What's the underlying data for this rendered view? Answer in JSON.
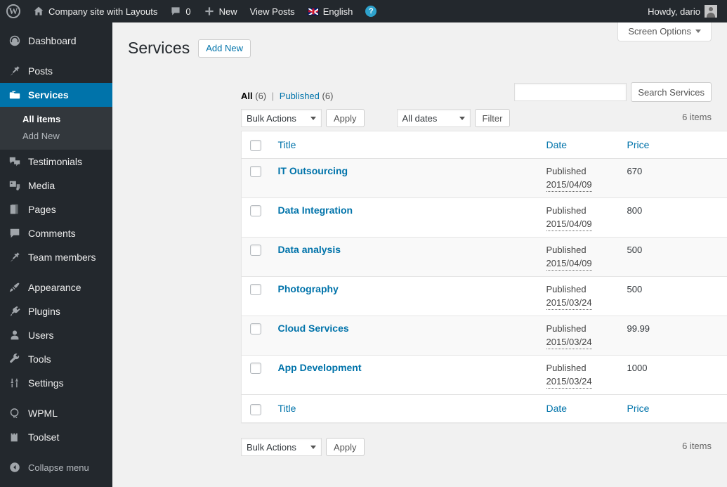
{
  "adminbar": {
    "logo_icon": "wordpress-logo",
    "site_icon": "home-icon",
    "site_name": "Company site with Layouts",
    "comments_icon": "comment-bubble-icon",
    "comments_count": "0",
    "new_icon": "plus-icon",
    "new_label": "New",
    "view_posts_label": "View Posts",
    "language_flag": "uk-flag-icon",
    "language_label": "English",
    "help_icon": "help-question-icon",
    "howdy": "Howdy, dario",
    "avatar": "user-avatar"
  },
  "sidebar": {
    "items": [
      {
        "label": "Dashboard",
        "icon": "dashboard-gauge-icon",
        "current": false
      },
      {
        "label": "Posts",
        "icon": "pushpin-icon",
        "current": false
      },
      {
        "label": "Services",
        "icon": "folder-icon",
        "current": true
      },
      {
        "label": "Testimonials",
        "icon": "testimonials-quote-icon",
        "current": false
      },
      {
        "label": "Media",
        "icon": "media-icon",
        "current": false
      },
      {
        "label": "Pages",
        "icon": "pages-icon",
        "current": false
      },
      {
        "label": "Comments",
        "icon": "comment-bubble-icon",
        "current": false
      },
      {
        "label": "Team members",
        "icon": "pushpin-icon",
        "current": false
      },
      {
        "label": "Appearance",
        "icon": "paintbrush-icon",
        "current": false
      },
      {
        "label": "Plugins",
        "icon": "plug-icon",
        "current": false
      },
      {
        "label": "Users",
        "icon": "user-icon",
        "current": false
      },
      {
        "label": "Tools",
        "icon": "wrench-icon",
        "current": false
      },
      {
        "label": "Settings",
        "icon": "settings-sliders-icon",
        "current": false
      },
      {
        "label": "WPML",
        "icon": "wpml-icon",
        "current": false
      },
      {
        "label": "Toolset",
        "icon": "toolset-icon",
        "current": false
      }
    ],
    "submenu": [
      {
        "label": "All items",
        "current": true
      },
      {
        "label": "Add New",
        "current": false
      }
    ],
    "collapse": {
      "label": "Collapse menu",
      "icon": "collapse-arrow-icon"
    }
  },
  "screen_options": {
    "label": "Screen Options",
    "icon": "chevron-down-icon"
  },
  "page": {
    "title": "Services",
    "add_new_label": "Add New"
  },
  "views": {
    "all_label": "All",
    "all_count": "(6)",
    "divider": "|",
    "published_label": "Published",
    "published_count": "(6)"
  },
  "search": {
    "value": "",
    "placeholder": "",
    "button_label": "Search Services"
  },
  "tablenav_top": {
    "bulk_label": "Bulk Actions",
    "apply_label": "Apply",
    "dates_label": "All dates",
    "filter_label": "Filter",
    "count_label": "6 items"
  },
  "tablenav_bottom": {
    "bulk_label": "Bulk Actions",
    "apply_label": "Apply",
    "count_label": "6 items"
  },
  "table": {
    "columns": {
      "title": "Title",
      "date": "Date",
      "price": "Price"
    },
    "rows": [
      {
        "title": "IT Outsourcing",
        "status": "Published",
        "date": "2015/04/09",
        "price": "670"
      },
      {
        "title": "Data Integration",
        "status": "Published",
        "date": "2015/04/09",
        "price": "800"
      },
      {
        "title": "Data analysis",
        "status": "Published",
        "date": "2015/04/09",
        "price": "500"
      },
      {
        "title": "Photography",
        "status": "Published",
        "date": "2015/03/24",
        "price": "500"
      },
      {
        "title": "Cloud Services",
        "status": "Published",
        "date": "2015/03/24",
        "price": "99.99"
      },
      {
        "title": "App Development",
        "status": "Published",
        "date": "2015/03/24",
        "price": "1000"
      }
    ]
  },
  "colors": {
    "admin_bar": "#23282d",
    "sidebar": "#23282d",
    "submenu": "#32373c",
    "accent": "#0073aa",
    "link": "#0073aa",
    "content_bg": "#f1f1f1",
    "row_alt": "#f9f9f9"
  }
}
